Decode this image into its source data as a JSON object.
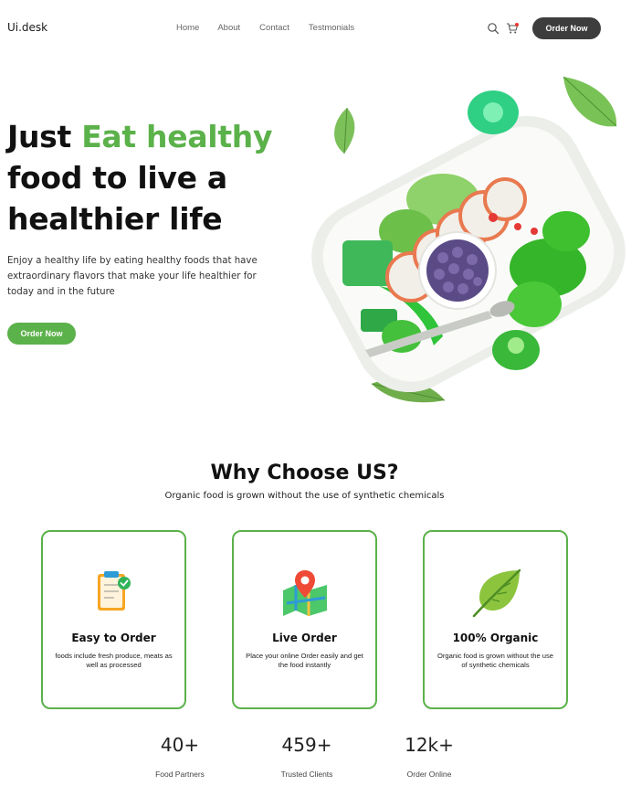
{
  "nav": {
    "logo": "Ui.desk",
    "links": [
      "Home",
      "About",
      "Contact",
      "Testmonials"
    ],
    "order_button": "Order Now",
    "icons": [
      "search-icon",
      "cart-icon"
    ],
    "cart_dot_color": "#e53935"
  },
  "hero": {
    "title_part1": "Just ",
    "title_highlight": "Eat healthy",
    "title_line2": "food to live a",
    "title_line3": "healthier life",
    "description": "Enjoy a healthy life by eating healthy foods that have extraordinary flavors that make your life healthier for today and in the future",
    "button": "Order Now",
    "image_alt": "Plate of green fruits"
  },
  "why": {
    "title": "Why Choose US?",
    "subtitle": "Organic food is grown without the use of synthetic chemicals",
    "cards": [
      {
        "icon": "clipboard-check-icon",
        "title": "Easy to Order",
        "text": "foods include fresh produce, meats as well as processed"
      },
      {
        "icon": "map-pin-icon",
        "title": "Live Order",
        "text": "Place your online Order easily and get the food instantly"
      },
      {
        "icon": "leaf-icon",
        "title": "100% Organic",
        "text": "Organic food is grown without the use of synthetic chemicals"
      }
    ]
  },
  "stats": [
    {
      "value": "40+",
      "label": "Food Partners"
    },
    {
      "value": "459+",
      "label": "Trusted Clients"
    },
    {
      "value": "12k+",
      "label": "Order Online"
    }
  ],
  "colors": {
    "accent": "#5bb14a",
    "dark_button": "#3d3d3d"
  }
}
